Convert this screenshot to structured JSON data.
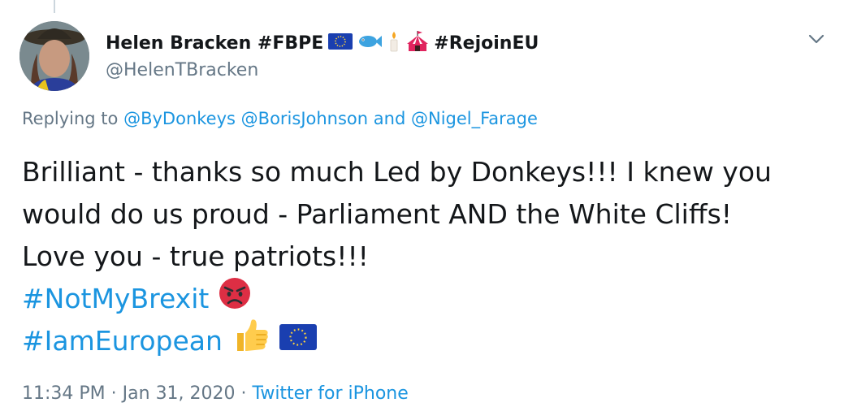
{
  "author": {
    "display_name": "Helen Bracken #FBPE",
    "display_name_suffix": "#RejoinEU",
    "handle": "@HelenTBracken",
    "name_emojis": [
      "eu-flag-icon",
      "fish-icon",
      "candle-icon",
      "circus-tent-icon"
    ]
  },
  "reply": {
    "prefix": "Replying to",
    "mention_1": "@ByDonkeys",
    "mention_2": "@BorisJohnson",
    "conjunction": "and",
    "mention_3": "@Nigel_Farage"
  },
  "tweet": {
    "line_1": "Brilliant - thanks so much Led by Donkeys!!! I knew you",
    "line_2": "would do us proud - Parliament AND the White Cliffs!",
    "line_3": "Love you - true patriots!!!",
    "hashtag_1": "#NotMyBrexit",
    "hashtag_2": "#IamEuropean"
  },
  "meta": {
    "time": "11:34 PM",
    "separator": "·",
    "date": "Jan 31, 2020",
    "source": "Twitter for iPhone"
  },
  "colors": {
    "link": "#1b95e0",
    "secondary_text": "#657786",
    "primary_text": "#14171a"
  }
}
